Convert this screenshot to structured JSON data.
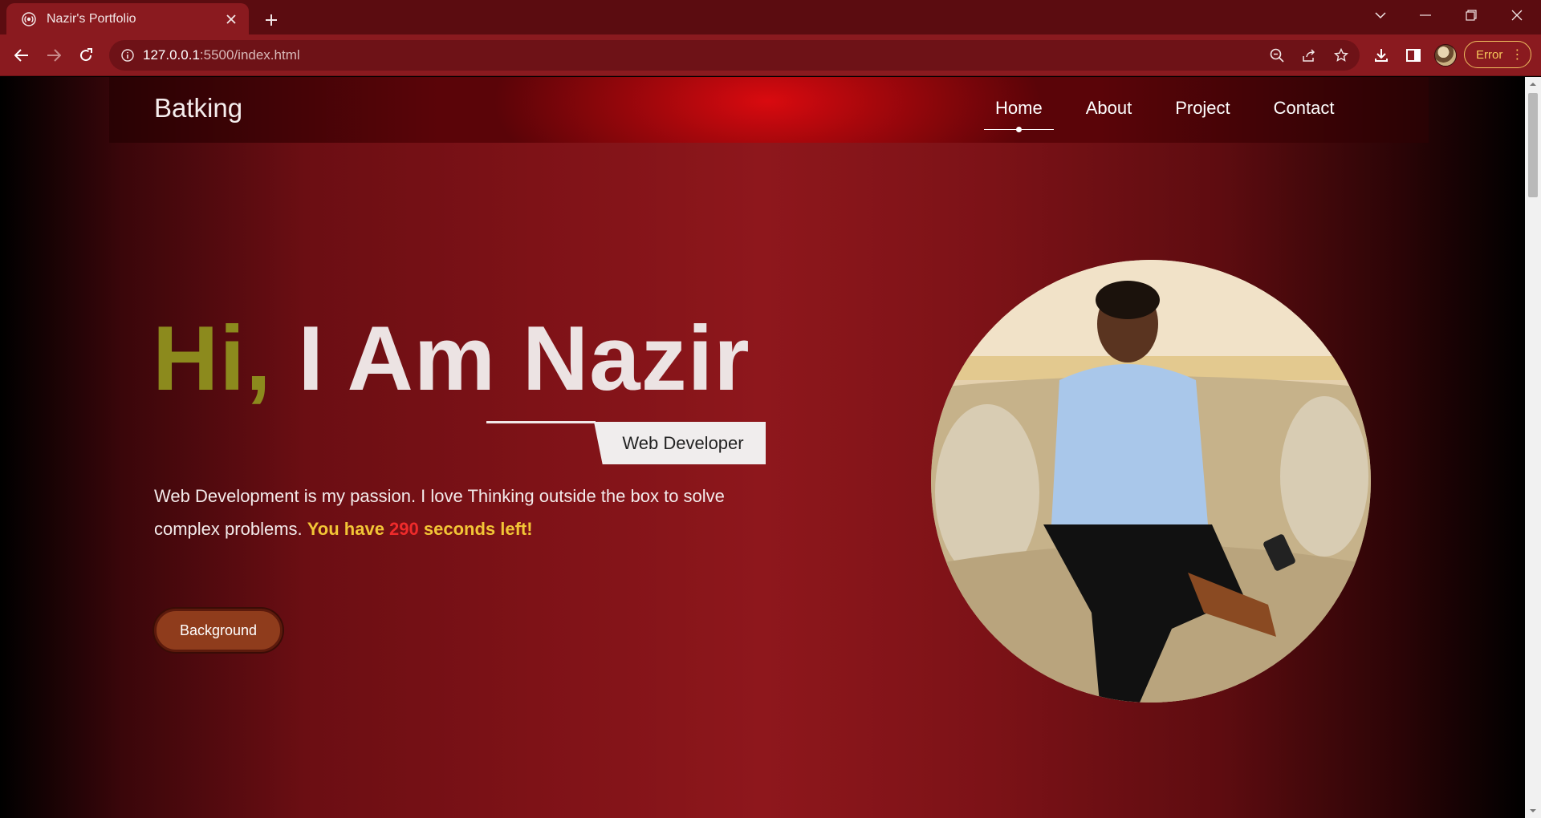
{
  "browser": {
    "tab_title": "Nazir's Portfolio",
    "url_host": "127.0.0.1",
    "url_rest": ":5500/index.html",
    "error_label": "Error"
  },
  "site": {
    "logo": "Batking",
    "nav": [
      {
        "label": "Home",
        "active": true
      },
      {
        "label": "About",
        "active": false
      },
      {
        "label": "Project",
        "active": false
      },
      {
        "label": "Contact",
        "active": false
      }
    ],
    "hero": {
      "greeting": "Hi,",
      "name": " I Am Nazir",
      "role": "Web Developer",
      "intro_text": "Web Development is my passion. I love Thinking outside the box to solve complex problems. ",
      "countdown_prefix": "You have ",
      "countdown_value": "290",
      "countdown_suffix": " seconds left!",
      "button_label": "Background"
    }
  },
  "colors": {
    "accent_olive": "#8c8a1d",
    "countdown_yellow": "#f2c536",
    "countdown_red": "#ef2b2b",
    "button_brown": "#8f3c1c"
  }
}
